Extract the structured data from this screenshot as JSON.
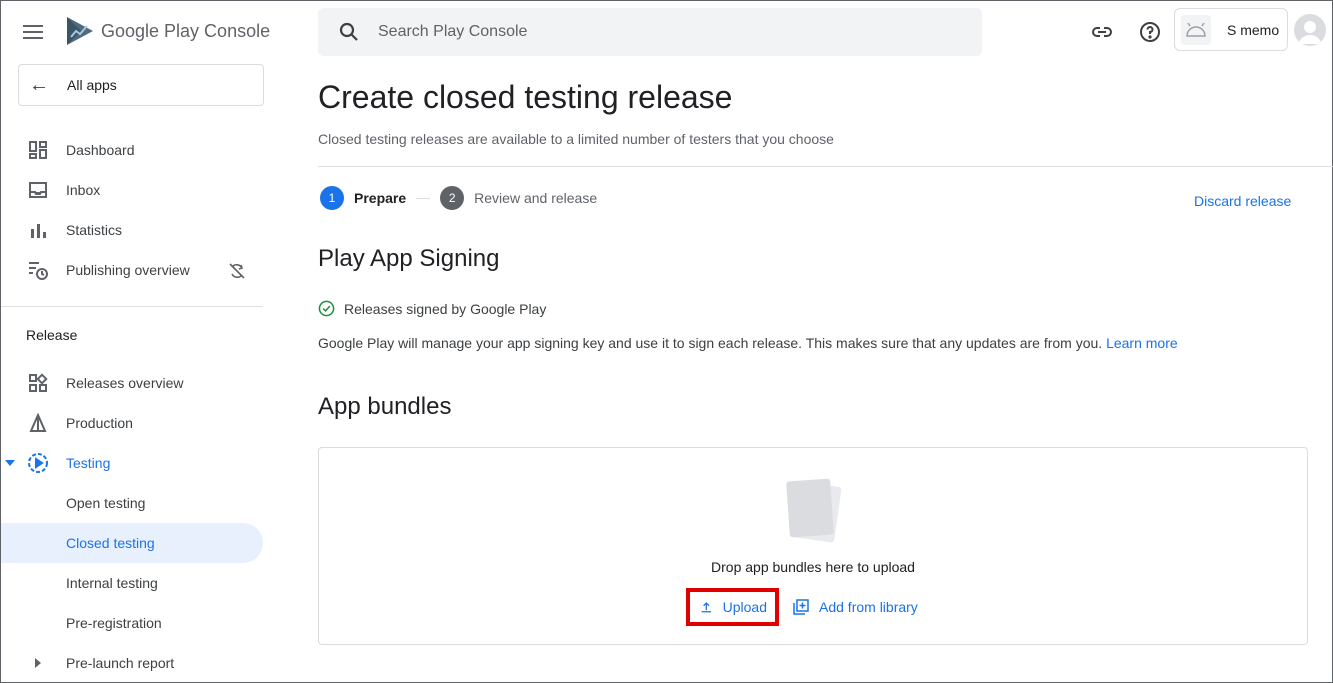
{
  "app": {
    "title": "Google Play Console"
  },
  "sidebar": {
    "all_apps": "All apps",
    "items": [
      {
        "label": "Dashboard",
        "icon": "dashboard-icon"
      },
      {
        "label": "Inbox",
        "icon": "inbox-icon"
      },
      {
        "label": "Statistics",
        "icon": "bar-chart-icon"
      },
      {
        "label": "Publishing overview",
        "icon": "publishing-overview-icon"
      }
    ],
    "section_release": "Release",
    "release_items": [
      {
        "label": "Releases overview",
        "icon": "releases-overview-icon"
      },
      {
        "label": "Production",
        "icon": "production-icon"
      },
      {
        "label": "Testing",
        "icon": "testing-icon",
        "expanded": true
      },
      {
        "label": "Open testing"
      },
      {
        "label": "Closed testing",
        "selected": true
      },
      {
        "label": "Internal testing"
      },
      {
        "label": "Pre-registration"
      },
      {
        "label": "Pre-launch report",
        "icon": "chevron-right-icon"
      }
    ]
  },
  "topbar": {
    "search_placeholder": "Search Play Console",
    "app_name": "S memo",
    "icons": [
      "link-icon",
      "help-icon",
      "android-icon",
      "account-avatar-icon"
    ]
  },
  "main": {
    "title": "Create closed testing release",
    "subtitle": "Closed testing releases are available to a limited number of testers that you choose",
    "steps": [
      {
        "num": "1",
        "label": "Prepare",
        "active": true
      },
      {
        "num": "2",
        "label": "Review and release",
        "active": false
      }
    ],
    "discard": "Discard release",
    "signing": {
      "heading": "Play App Signing",
      "status": "Releases signed by Google Play",
      "description": "Google Play will manage your app signing key and use it to sign each release. This makes sure that any updates are from you.",
      "learn_more": "Learn more"
    },
    "bundles": {
      "heading": "App bundles",
      "drop_text": "Drop app bundles here to upload",
      "upload": "Upload",
      "add_from_library": "Add from library"
    }
  },
  "colors": {
    "accent": "#1a73e8",
    "highlight": "#e00000",
    "success": "#1e8e3e"
  }
}
